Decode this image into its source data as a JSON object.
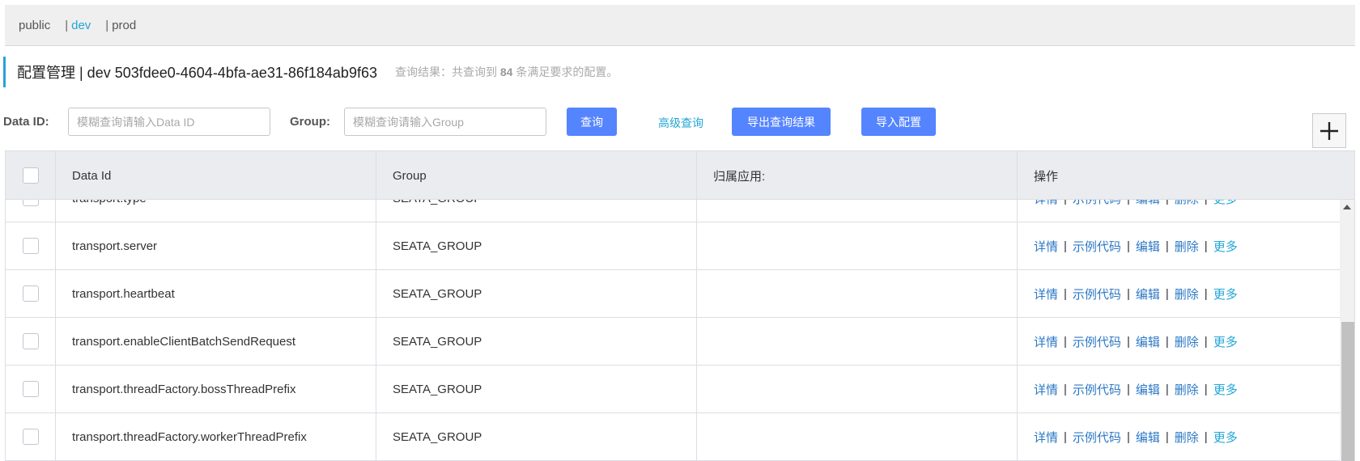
{
  "namespaces": {
    "items": [
      "public",
      "dev",
      "prod"
    ],
    "active": "dev",
    "separator": "|"
  },
  "header": {
    "title": "配置管理  |  dev  503fdee0-4604-4bfa-ae31-86f184ab9f63",
    "result_prefix": "查询结果：共查询到",
    "result_count": "84",
    "result_suffix": "条满足要求的配置。"
  },
  "search": {
    "data_id_label": "Data ID:",
    "data_id_placeholder": "模糊查询请输入Data ID",
    "group_label": "Group:",
    "group_placeholder": "模糊查询请输入Group",
    "query_button": "查询",
    "advanced_link": "高级查询",
    "export_button": "导出查询结果",
    "import_button": "导入配置",
    "add_icon": "plus-icon"
  },
  "table": {
    "columns": [
      "Data Id",
      "Group",
      "归属应用:",
      "操作"
    ],
    "actions": [
      "详情",
      "示例代码",
      "编辑",
      "删除",
      "更多"
    ],
    "rows": [
      {
        "data_id": "transport.type",
        "group": "SEATA_GROUP",
        "app": ""
      },
      {
        "data_id": "transport.server",
        "group": "SEATA_GROUP",
        "app": ""
      },
      {
        "data_id": "transport.heartbeat",
        "group": "SEATA_GROUP",
        "app": ""
      },
      {
        "data_id": "transport.enableClientBatchSendRequest",
        "group": "SEATA_GROUP",
        "app": ""
      },
      {
        "data_id": "transport.threadFactory.bossThreadPrefix",
        "group": "SEATA_GROUP",
        "app": ""
      },
      {
        "data_id": "transport.threadFactory.workerThreadPrefix",
        "group": "SEATA_GROUP",
        "app": ""
      }
    ]
  },
  "colors": {
    "accent": "#2aa3d6",
    "primary_button": "#5584ff",
    "link": "#2b78c5",
    "more_link": "#23a6d5"
  }
}
